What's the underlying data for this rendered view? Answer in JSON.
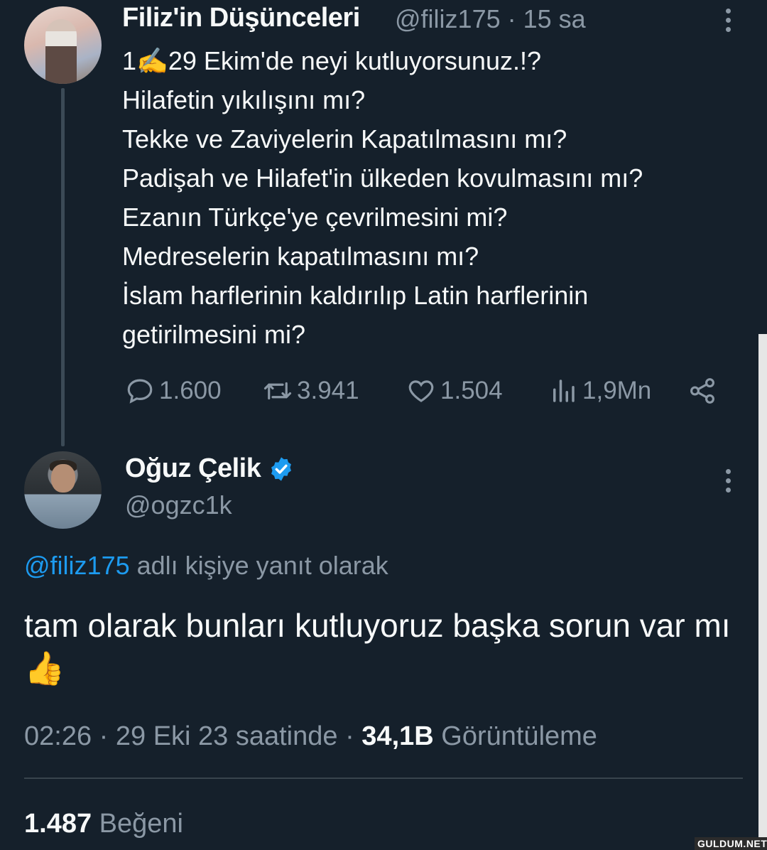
{
  "parent_tweet": {
    "author_name": "Filiz'in Düşünceleri",
    "meta": "@filiz175 · 15 sa",
    "lines": [
      "1✍️29 Ekim'de neyi kutluyorsunuz.!?",
      "Hilafetin yıkılışını mı?",
      "Tekke ve Zaviyelerin Kapatılmasını mı?",
      "Padişah ve Hilafet'in ülkeden kovulmasını mı?",
      "Ezanın Türkçe'ye çevrilmesini mi?",
      "Medreselerin kapatılmasını mı?",
      "İslam harflerinin kaldırılıp Latin harflerinin",
      "getirilmesini mi?"
    ],
    "actions": {
      "replies": "1.600",
      "retweets": "3.941",
      "likes": "1.504",
      "views": "1,9Mn"
    }
  },
  "reply_tweet": {
    "author_name": "Oğuz Çelik",
    "handle": "@ogzc1k",
    "replying_mention": "@filiz175",
    "replying_suffix": " adlı kişiye yanıt olarak",
    "text": "tam olarak bunları kutluyoruz başka sorun var mı👍",
    "time_date": "02:26 · 29 Eki 23 saatinde · ",
    "views_count": "34,1B",
    "views_label": " Görüntüleme",
    "likes_count": "1.487",
    "likes_label": " Beğeni"
  },
  "watermark": "GULDUM.NET",
  "colors": {
    "background": "#15202b",
    "text_primary": "#f7f9f9",
    "text_secondary": "#8b98a5",
    "accent": "#1d9bf0"
  },
  "icons": [
    "reply-icon",
    "retweet-icon",
    "like-icon",
    "views-icon",
    "share-icon",
    "verified-badge-icon",
    "more-icon"
  ]
}
